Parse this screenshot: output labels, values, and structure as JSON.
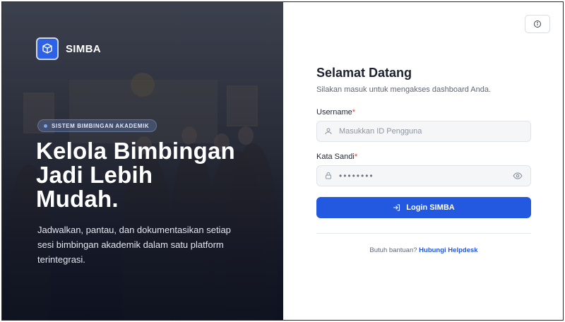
{
  "brand": {
    "name": "SIMBA",
    "logo_icon": "box-logo-icon"
  },
  "hero": {
    "badge": "SISTEM BIMBINGAN AKADEMIK",
    "headline_line1": "Kelola Bimbingan",
    "headline_line2": "Jadi Lebih",
    "headline_line3": "Mudah.",
    "description": "Jadwalkan, pantau, dan dokumentasikan setiap sesi bimbingan akademik dalam satu platform terintegrasi."
  },
  "login": {
    "title": "Selamat Datang",
    "subtitle": "Silakan masuk untuk mengakses dashboard Anda.",
    "username_label": "Username",
    "username_placeholder": "Masukkan ID Pengguna",
    "password_label": "Kata Sandi",
    "password_value": "••••••••",
    "required_mark": "*",
    "submit_label": "Login SIMBA",
    "help_text": "Butuh bantuan?",
    "help_link": "Hubungi Helpdesk"
  },
  "colors": {
    "accent": "#2358e0",
    "required": "#e0342f"
  }
}
